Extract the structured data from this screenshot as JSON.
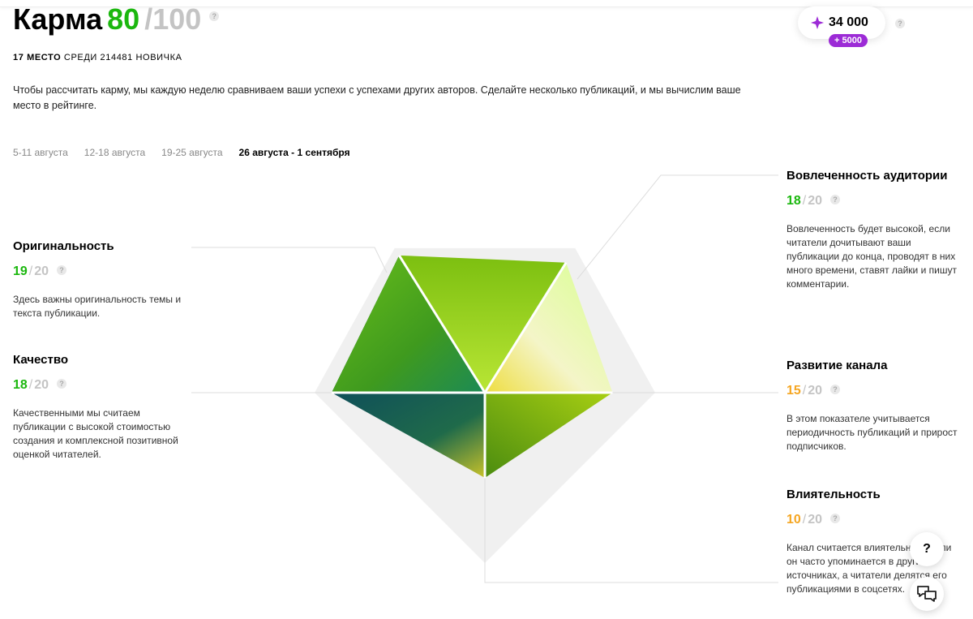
{
  "header": {
    "title": "Карма",
    "score": "80",
    "max": "/100",
    "rank_place": "17 МЕСТО",
    "rank_rest": "СРЕДИ 214481 НОВИЧКА",
    "description": "Чтобы рассчитать карму, мы каждую неделю сравниваем ваши успехи с успехами других авторов. Сделайте несколько публикаций, и мы вычислим ваше место в рейтинге.",
    "help": "?"
  },
  "coins": {
    "amount": "34 000",
    "bonus": "+ 5000"
  },
  "weeks": [
    {
      "label": "5-11 августа",
      "active": false
    },
    {
      "label": "12-18 августа",
      "active": false
    },
    {
      "label": "19-25 августа",
      "active": false
    },
    {
      "label": "26 августа - 1 сентября",
      "active": true
    }
  ],
  "metrics": {
    "originality": {
      "name": "Оригинальность",
      "score": "19",
      "of": "20",
      "text": "Здесь важны оригинальность темы и текста публикации."
    },
    "quality": {
      "name": "Качество",
      "score": "18",
      "of": "20",
      "text": "Качественными мы считаем публикации с высокой стоимостью создания и комплексной позитивной оценкой читателей."
    },
    "engagement": {
      "name": "Вовлеченность аудитории",
      "score": "18",
      "of": "20",
      "text": "Вовлеченность будет высокой, если читатели дочитывают ваши публикации до конца, проводят в них много времени, ставят лайки и пишут комментарии."
    },
    "growth": {
      "name": "Развитие канала",
      "score": "15",
      "of": "20",
      "text": "В этом показателе учитывается периодичность публикаций и прирост подписчиков."
    },
    "influence": {
      "name": "Влиятельность",
      "score": "10",
      "of": "20",
      "text": "Канал считается влиятельным, если он часто упоминается в других источниках, а читатели делятся его публикациями в соцсетях."
    }
  },
  "chart_data": {
    "type": "radar",
    "max": 20,
    "axes": [
      "Оригинальность",
      "Вовлеченность аудитории",
      "Развитие канала",
      "Влиятельность",
      "Качество"
    ],
    "values": [
      19,
      18,
      15,
      10,
      18
    ]
  },
  "colors": {
    "green": "#1bb70e",
    "orange": "#f5a623",
    "purple": "#9c2bd6"
  },
  "icons": {
    "gem": "diamond-gem-icon",
    "help": "question-icon",
    "chat": "chat-icon"
  },
  "fab": {
    "help_label": "?"
  }
}
